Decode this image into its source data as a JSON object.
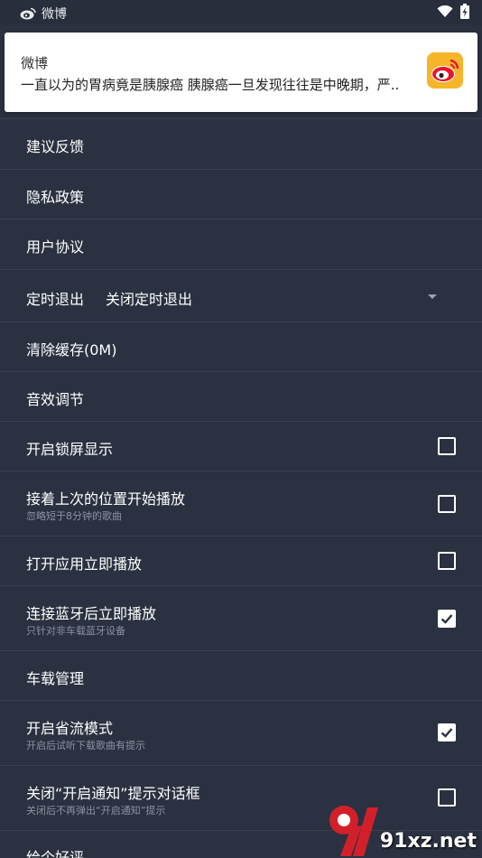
{
  "status_bar": {
    "app_name": "微博",
    "icons": [
      "weibo-icon",
      "wifi-icon",
      "battery-charging-icon"
    ]
  },
  "notification": {
    "app": "微博",
    "text": "一直以为的胃病竟是胰腺癌 胰腺癌一旦发现往往是中晚期，严..",
    "icon": "weibo-logo-icon"
  },
  "settings": {
    "feedback": "建议反馈",
    "privacy": "隐私政策",
    "agreement": "用户协议",
    "timer": {
      "label": "定时退出",
      "value": "关闭定时退出"
    },
    "clear_cache": "清除缓存(0M)",
    "audio": "音效调节",
    "lockscreen": {
      "label": "开启锁屏显示",
      "checked": false
    },
    "resume": {
      "label": "接着上次的位置开始播放",
      "sub": "忽略短于8分钟的歌曲",
      "checked": false
    },
    "autoplay_open": {
      "label": "打开应用立即播放",
      "checked": false
    },
    "bluetooth": {
      "label": "连接蓝牙后立即播放",
      "sub": "只针对非车载蓝牙设备",
      "checked": true
    },
    "car": "车载管理",
    "data_saver": {
      "label": "开启省流模式",
      "sub": "开启后试听下载歌曲有提示",
      "checked": true
    },
    "close_notify": {
      "label": "关闭“开启通知”提示对话框",
      "sub": "关闭后不再弹出“开启通知”提示",
      "checked": false
    },
    "rate": "给个好评"
  },
  "watermark": {
    "text": "91xz.net"
  },
  "colors": {
    "background": "#2b3140",
    "divider": "#3a4150",
    "subtext": "#8a93a3",
    "weibo_orange": "#f7b52c",
    "weibo_red": "#e6162d"
  }
}
